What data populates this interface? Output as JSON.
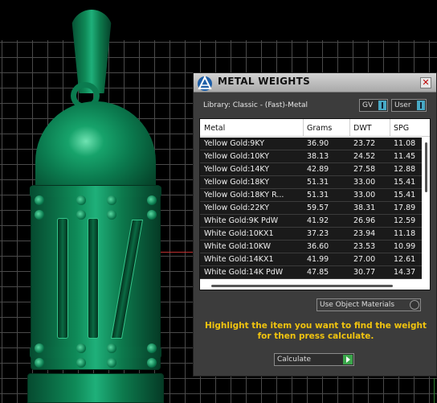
{
  "panel": {
    "title": "METAL WEIGHTS",
    "close_glyph": "✕",
    "library_label": "Library: Classic - (Fast)-Metal",
    "toggles": {
      "gv": "GV",
      "user": "User"
    },
    "table": {
      "headers": [
        "Metal",
        "Grams",
        "DWT",
        "SPG"
      ],
      "rows": [
        {
          "metal": "Yellow Gold:9KY",
          "grams": "36.90",
          "dwt": "23.72",
          "spg": "11.08"
        },
        {
          "metal": "Yellow Gold:10KY",
          "grams": "38.13",
          "dwt": "24.52",
          "spg": "11.45"
        },
        {
          "metal": "Yellow Gold:14KY",
          "grams": "42.89",
          "dwt": "27.58",
          "spg": "12.88"
        },
        {
          "metal": "Yellow Gold:18KY",
          "grams": "51.31",
          "dwt": "33.00",
          "spg": "15.41"
        },
        {
          "metal": "Yellow Gold:18KY R...",
          "grams": "51.31",
          "dwt": "33.00",
          "spg": "15.41"
        },
        {
          "metal": "Yellow Gold:22KY",
          "grams": "59.57",
          "dwt": "38.31",
          "spg": "17.89"
        },
        {
          "metal": "White Gold:9K PdW",
          "grams": "41.92",
          "dwt": "26.96",
          "spg": "12.59"
        },
        {
          "metal": "White Gold:10KX1",
          "grams": "37.23",
          "dwt": "23.94",
          "spg": "11.18"
        },
        {
          "metal": "White Gold:10KW",
          "grams": "36.60",
          "dwt": "23.53",
          "spg": "10.99"
        },
        {
          "metal": "White Gold:14KX1",
          "grams": "41.99",
          "dwt": "27.00",
          "spg": "12.61"
        },
        {
          "metal": "White Gold:14K PdW",
          "grams": "47.85",
          "dwt": "30.77",
          "spg": "14.37"
        }
      ]
    },
    "use_object_materials": "Use Object Materials",
    "hint": "Highlight the item you want to find the weight for then press calculate.",
    "calculate_label": "Calculate"
  },
  "colors": {
    "hint_text": "#f1c40f",
    "pendant": "#0b7b4f",
    "toggle_knob": "#48a9c5",
    "calculate_play": "#3aa64a"
  }
}
